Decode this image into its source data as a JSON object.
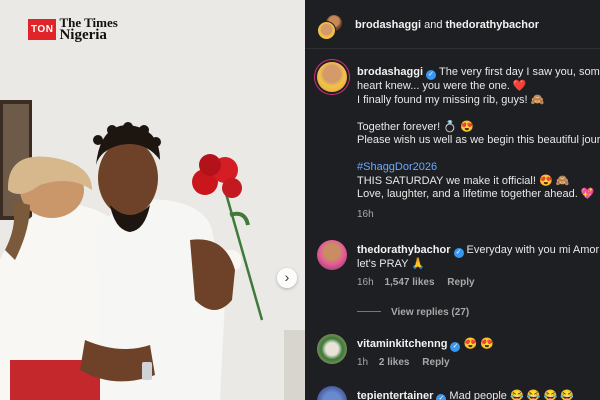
{
  "logo": {
    "badge": "TON",
    "line1": "The Times",
    "line2": "Nigeria"
  },
  "carousel": {
    "next_icon": "›"
  },
  "header": {
    "user1": "brodashaggi",
    "connector": "and",
    "user2": "thedorathybachor"
  },
  "caption": {
    "username": "brodashaggi",
    "lines": [
      "The very first day I saw you, some",
      "heart knew... you were the one. ❤️",
      "I finally found my missing rib, guys! 🙈",
      "",
      "Together forever! 💍 😍",
      "Please wish us well as we begin this beautiful jour",
      "",
      "#ShaggDor2026",
      "THIS SATURDAY we make it official! 😍 🙈",
      "Love, laughter, and a lifetime together ahead. 💖"
    ],
    "time": "16h"
  },
  "comments": [
    {
      "username": "thedorathybachor",
      "text_line1": "Everyday with you mi Amor",
      "text_line2": "let's PRAY 🙏",
      "time": "16h",
      "likes": "1,547 likes",
      "reply": "Reply",
      "view_replies": "View replies (27)"
    },
    {
      "username": "vitaminkitchenng",
      "text_line1": "😍 😍",
      "time": "1h",
      "likes": "2 likes",
      "reply": "Reply"
    },
    {
      "username": "tepientertainer",
      "text_line1": "Mad people 😂 😂 😂 😂"
    }
  ],
  "colors": {
    "panel_bg": "#1e1f22",
    "link": "#6aa9ff",
    "verified": "#3897f0",
    "brand_red": "#e0242a"
  }
}
